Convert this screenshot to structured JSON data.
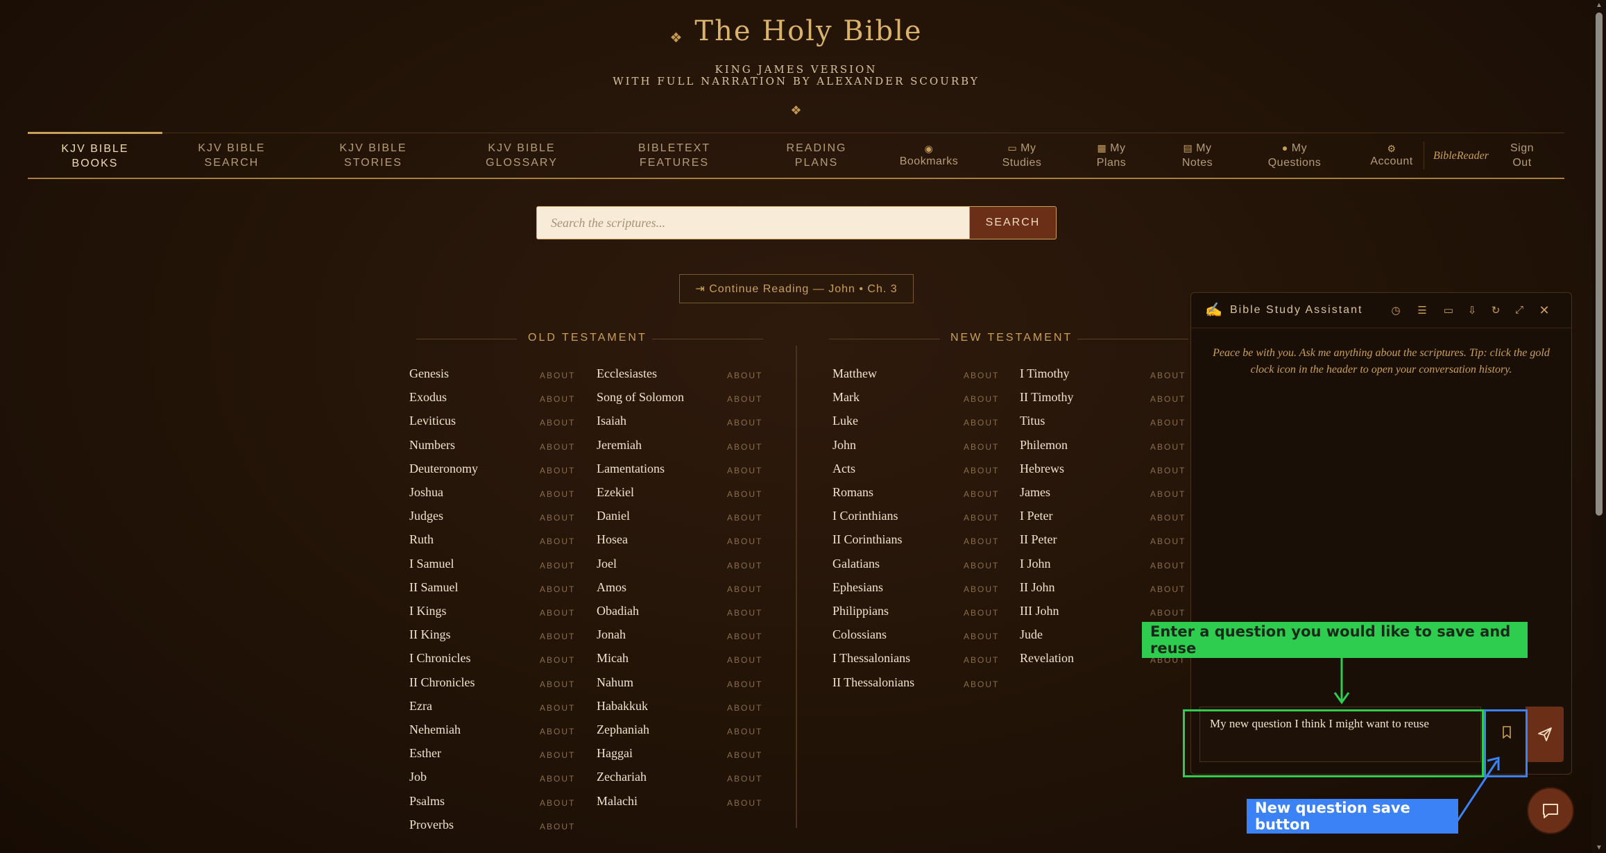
{
  "header": {
    "ornament": "❖",
    "title": "The Holy Bible",
    "subtitle1": "KING JAMES VERSION",
    "subtitle2": "WITH FULL NARRATION BY ALEXANDER SCOURBY",
    "divider_ornament": "❖"
  },
  "nav": {
    "books": [
      "KJV BIBLE",
      "BOOKS"
    ],
    "search": [
      "KJV BIBLE",
      "SEARCH"
    ],
    "stories": [
      "KJV BIBLE",
      "STORIES"
    ],
    "glossary": [
      "KJV BIBLE",
      "GLOSSARY"
    ],
    "features": [
      "BIBLETEXT",
      "FEATURES"
    ],
    "plans": [
      "READING",
      "PLANS"
    ],
    "bookmarks": "Bookmarks",
    "studies": [
      "My",
      "Studies"
    ],
    "myplans": [
      "My",
      "Plans"
    ],
    "notes": [
      "My",
      "Notes"
    ],
    "questions": [
      "My",
      "Questions"
    ],
    "account": "Account",
    "brand": "BibleReader",
    "signout": [
      "Sign",
      "Out"
    ]
  },
  "search": {
    "placeholder": "Search the scriptures...",
    "button": "SEARCH"
  },
  "continue_label": "⇥ Continue Reading — John • Ch. 3",
  "old_testament": {
    "heading": "OLD TESTAMENT",
    "col1": [
      "Genesis",
      "Exodus",
      "Leviticus",
      "Numbers",
      "Deuteronomy",
      "Joshua",
      "Judges",
      "Ruth",
      "I Samuel",
      "II Samuel",
      "I Kings",
      "II Kings",
      "I Chronicles",
      "II Chronicles",
      "Ezra",
      "Nehemiah",
      "Esther",
      "Job",
      "Psalms",
      "Proverbs"
    ],
    "col2": [
      "Ecclesiastes",
      "Song of Solomon",
      "Isaiah",
      "Jeremiah",
      "Lamentations",
      "Ezekiel",
      "Daniel",
      "Hosea",
      "Joel",
      "Amos",
      "Obadiah",
      "Jonah",
      "Micah",
      "Nahum",
      "Habakkuk",
      "Zephaniah",
      "Haggai",
      "Zechariah",
      "Malachi"
    ]
  },
  "new_testament": {
    "heading": "NEW TESTAMENT",
    "col1": [
      "Matthew",
      "Mark",
      "Luke",
      "John",
      "Acts",
      "Romans",
      "I Corinthians",
      "II Corinthians",
      "Galatians",
      "Ephesians",
      "Philippians",
      "Colossians",
      "I Thessalonians",
      "II Thessalonians"
    ],
    "col2": [
      "I Timothy",
      "II Timothy",
      "Titus",
      "Philemon",
      "Hebrews",
      "James",
      "I Peter",
      "II Peter",
      "I John",
      "II John",
      "III John",
      "Jude",
      "Revelation"
    ]
  },
  "about_label": "ABOUT",
  "assistant": {
    "title": "Bible Study Assistant",
    "welcome": "Peace be with you. Ask me anything about the scriptures. Tip: click the gold clock icon in the header to open your conversation history.",
    "input_value": "My new question I think I might want to reuse"
  },
  "annotations": {
    "green_label": "Enter a question you would like to save and reuse",
    "blue_label": "New question save button",
    "green_color": "#2ecc4f",
    "blue_color": "#3b82f6"
  },
  "colors": {
    "accent": "#c9a05a",
    "button": "#6b2e17",
    "background": "#221307"
  }
}
